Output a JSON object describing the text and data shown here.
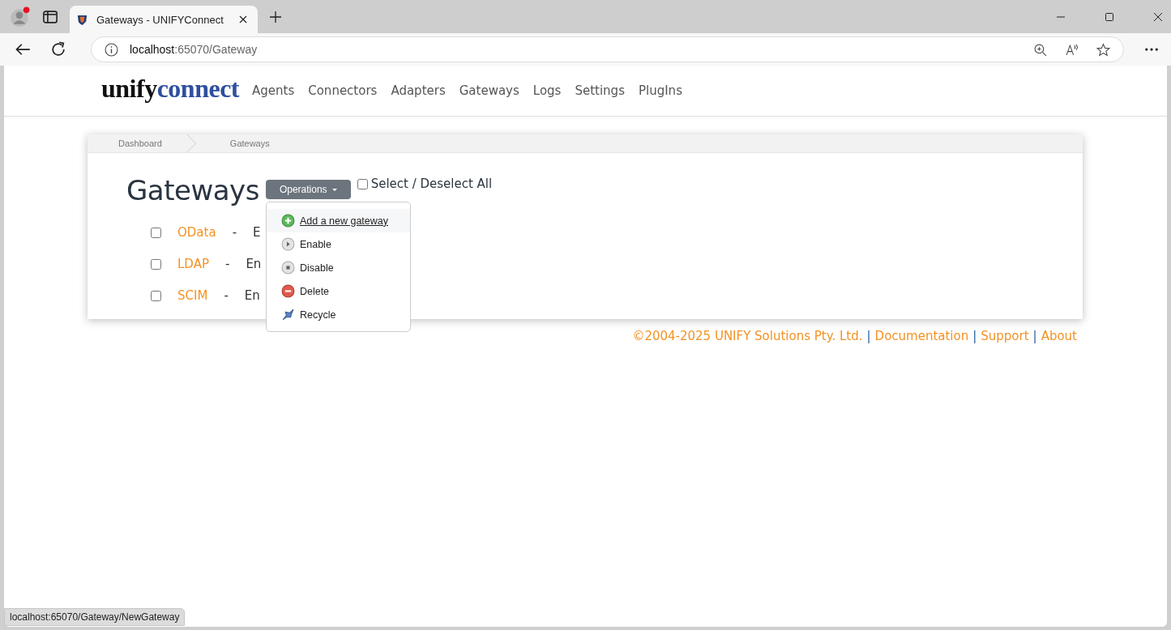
{
  "browser": {
    "tab": {
      "title": "Gateways - UNIFYConnect",
      "selected": true
    },
    "address": {
      "host": "localhost",
      "path": ":65070/Gateway"
    }
  },
  "logo": {
    "part_1": "unify",
    "part_2": "connect"
  },
  "nav": [
    "Agents",
    "Connectors",
    "Adapters",
    "Gateways",
    "Logs",
    "Settings",
    "PlugIns"
  ],
  "breadcrumb": [
    "Dashboard",
    "Gateways"
  ],
  "heading": "Gateways",
  "operations_button": "Operations",
  "select_all": {
    "label": "Select / Deselect All",
    "checked": false
  },
  "menu": [
    {
      "kind": "add",
      "label": "Add a new gateway",
      "selected": true
    },
    {
      "kind": "enable",
      "label": "Enable",
      "selected": false
    },
    {
      "kind": "disable",
      "label": "Disable",
      "selected": false
    },
    {
      "kind": "delete",
      "label": "Delete",
      "selected": false
    },
    {
      "kind": "recycle",
      "label": "Recycle",
      "selected": false
    }
  ],
  "gateways": [
    {
      "name": "OData",
      "separator": "-",
      "status": "E",
      "checked": false
    },
    {
      "name": "LDAP",
      "separator": "-",
      "status": "En",
      "checked": false
    },
    {
      "name": "SCIM",
      "separator": "-",
      "status": "En",
      "checked": false
    }
  ],
  "footer": {
    "copyright": "©2004-2025 UNIFY Solutions Pty. Ltd.",
    "separator": "|",
    "links": [
      "Documentation",
      "Support",
      "About"
    ]
  },
  "status_bar": "localhost:65070/Gateway/NewGateway"
}
